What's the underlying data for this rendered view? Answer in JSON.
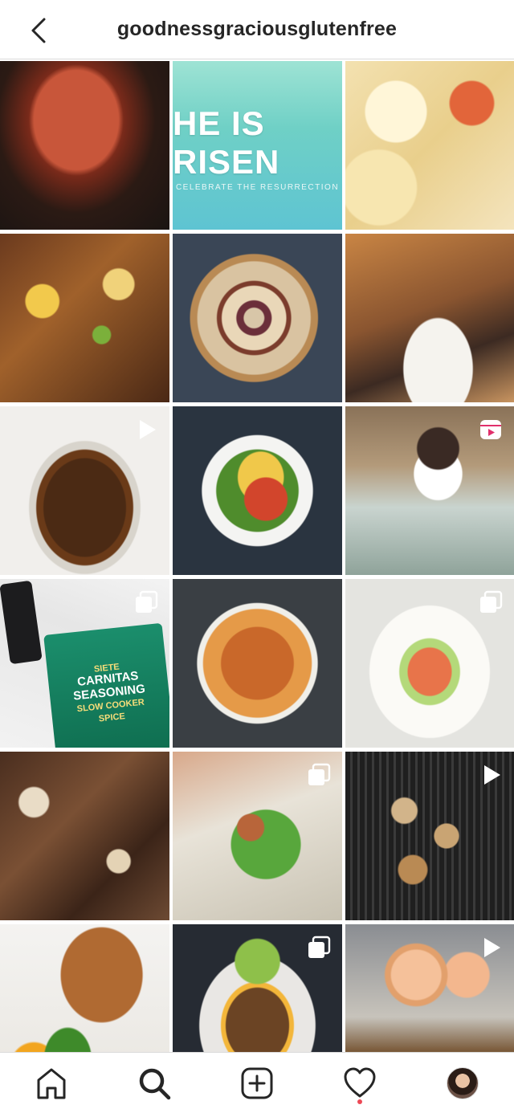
{
  "header": {
    "username": "goodnessgraciousglutenfree"
  },
  "grid": {
    "tiles": [
      {
        "subject": "smoked meat on grill",
        "type": "photo"
      },
      {
        "subject": "He is Risen graphic",
        "type": "photo",
        "headline": "HE IS RISEN",
        "subline": "CELEBRATE THE RESURRECTION"
      },
      {
        "subject": "lobster mac and cheese",
        "type": "photo"
      },
      {
        "subject": "loaded potato with bacon",
        "type": "photo"
      },
      {
        "subject": "wine cork board",
        "type": "photo"
      },
      {
        "subject": "steak dinner with wine",
        "type": "photo"
      },
      {
        "subject": "root beer in glass mug",
        "type": "video"
      },
      {
        "subject": "taco salad bowl",
        "type": "photo"
      },
      {
        "subject": "cookies and cream milkshake",
        "type": "reel"
      },
      {
        "subject": "carnitas seasoning pouch",
        "type": "carousel",
        "brand": "SIETE",
        "line1": "CARNITAS",
        "line2": "SEASONING",
        "line3": "SLOW COOKER",
        "line4": "SPICE"
      },
      {
        "subject": "chicken tortilla soup",
        "type": "photo"
      },
      {
        "subject": "smoked salmon wrap",
        "type": "carousel"
      },
      {
        "subject": "steak and mushrooms",
        "type": "photo"
      },
      {
        "subject": "lettuce wrap hot dog",
        "type": "carousel"
      },
      {
        "subject": "grilled chicken wings",
        "type": "video"
      },
      {
        "subject": "blackened fish with peppers",
        "type": "photo"
      },
      {
        "subject": "stuffed portobello mushroom",
        "type": "carousel"
      },
      {
        "subject": "baked eggs and hash",
        "type": "video"
      },
      {
        "subject": "partial tile",
        "type": "photo"
      },
      {
        "subject": "partial tile",
        "type": "photo"
      },
      {
        "subject": "partial tile",
        "type": "photo"
      }
    ]
  },
  "tabbar": {
    "items": [
      "home",
      "search",
      "create",
      "activity",
      "profile"
    ],
    "active": "search",
    "activity_has_notification": true
  },
  "colors": {
    "text": "#262626",
    "divider": "#dbdbdb",
    "notification": "#ed4956"
  }
}
